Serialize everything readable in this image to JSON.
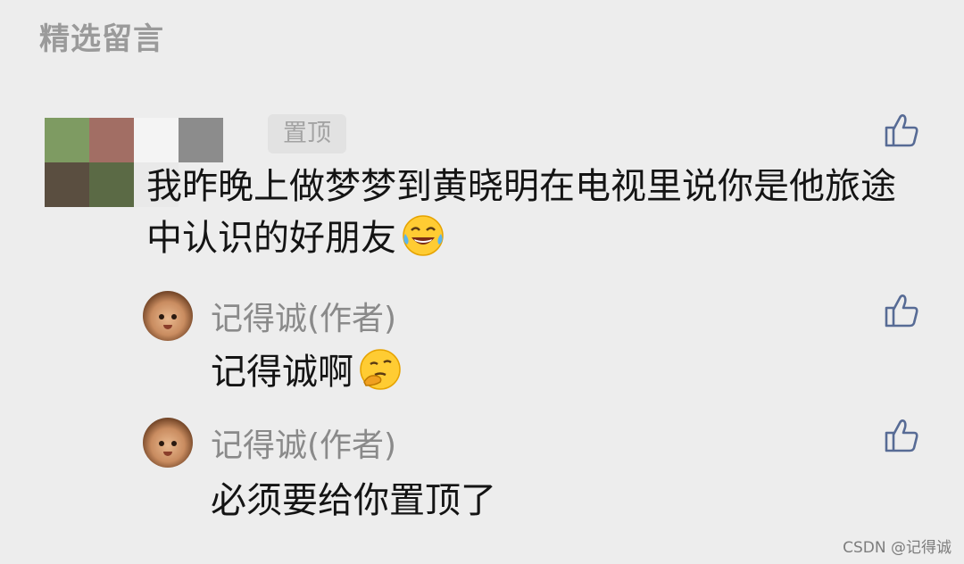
{
  "section": {
    "title": "精选留言"
  },
  "comment": {
    "pinned_label": "置顶",
    "text": "我昨晚上做梦梦到黄晓明在电视里说你是他旅途中认识的好朋友",
    "emoji": "tears-of-joy-emoji"
  },
  "replies": [
    {
      "author": "记得诚(作者)",
      "text": "记得诚啊",
      "emoji": "thinking-emoji"
    },
    {
      "author": "记得诚(作者)",
      "text": "必须要给你置顶了"
    }
  ],
  "watermark": "CSDN @记得诚",
  "colors": {
    "background": "#ededed",
    "like_icon": "#576b95",
    "muted_text": "#8a8a8a"
  }
}
